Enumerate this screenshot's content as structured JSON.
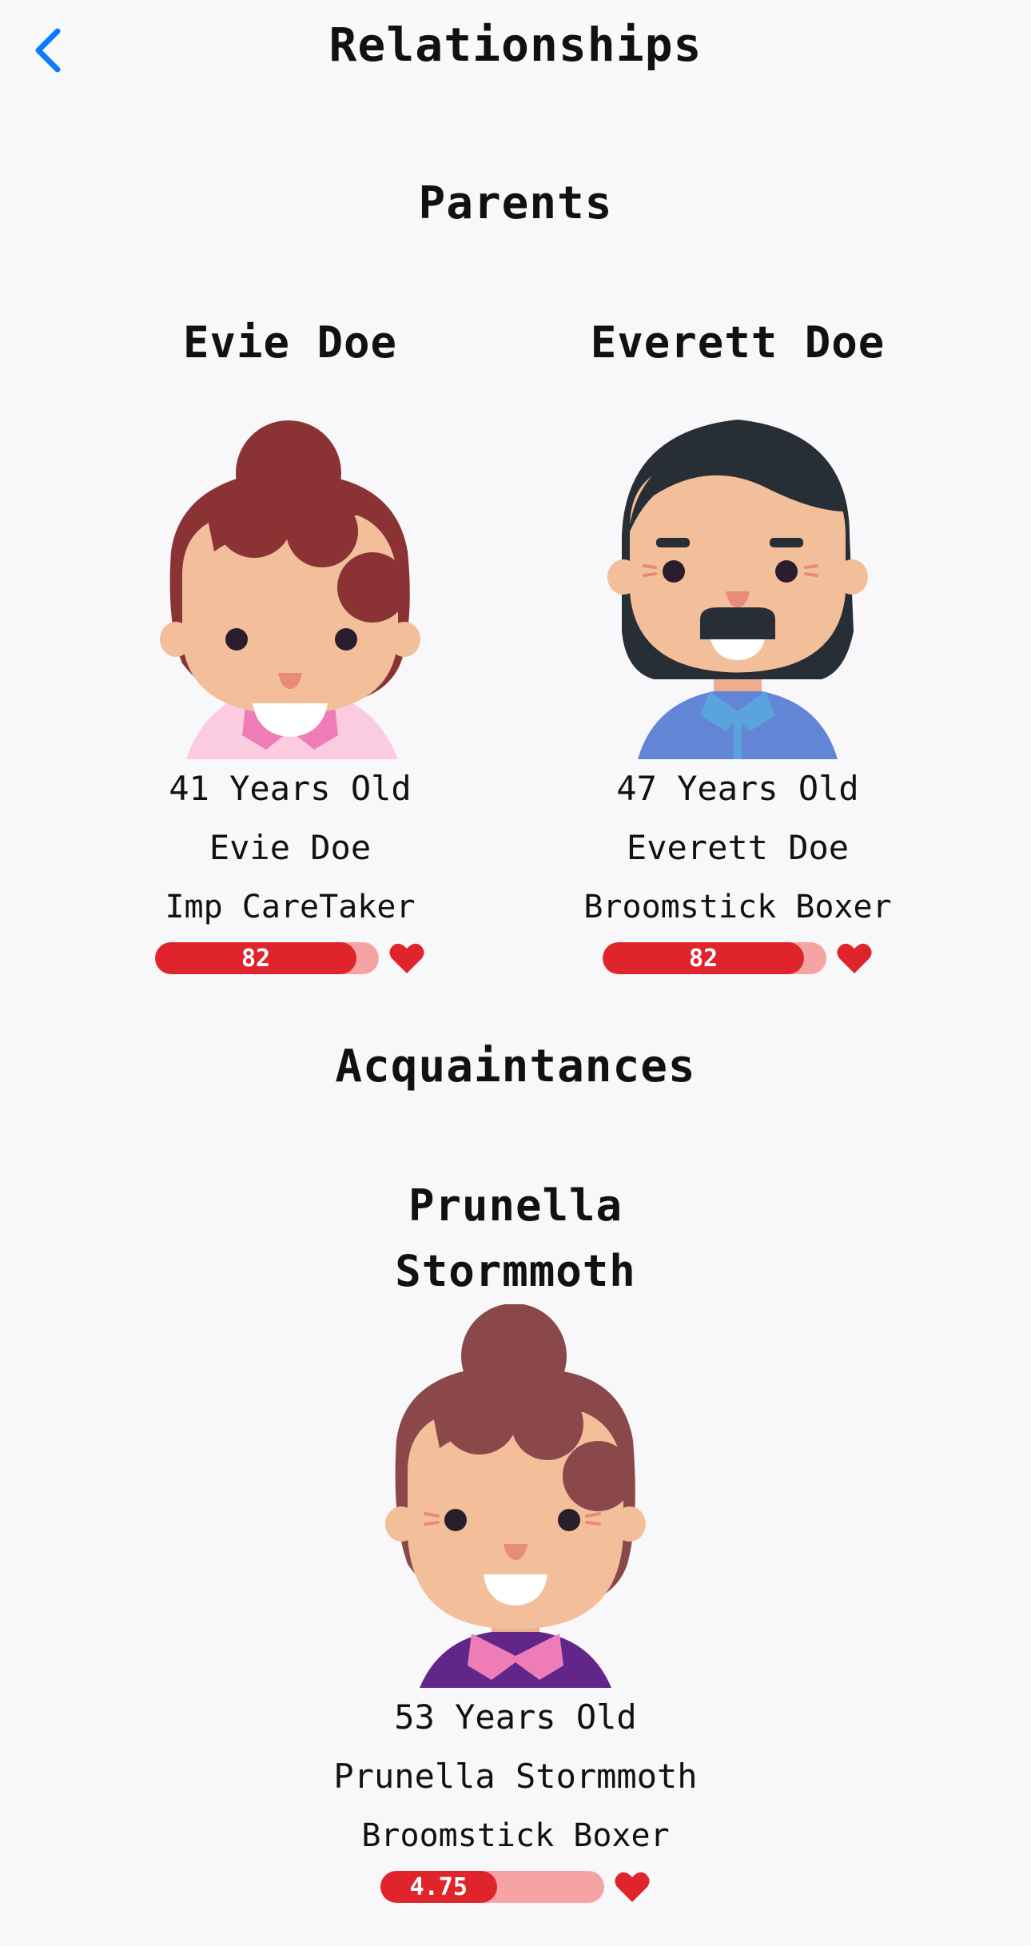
{
  "header": {
    "title": "Relationships"
  },
  "sections": [
    {
      "title": "Parents"
    },
    {
      "title": "Acquaintances"
    }
  ],
  "people": [
    {
      "name": "Evie Doe",
      "age_text": "41 Years Old",
      "full_name": "Evie Doe",
      "job": "Imp CareTaker",
      "relationship_value": 82,
      "relationship_fraction": 0.9
    },
    {
      "name": "Everett Doe",
      "age_text": "47 Years Old",
      "full_name": "Everett Doe",
      "job": "Broomstick Boxer",
      "relationship_value": 82,
      "relationship_fraction": 0.9
    },
    {
      "name": "Prunella Stormmoth",
      "age_text": "53 Years Old",
      "full_name": "Prunella Stormmoth",
      "job": "Broomstick Boxer",
      "relationship_value": 4.75,
      "relationship_fraction": 0.52
    }
  ],
  "colors": {
    "accent": "#0a7aff",
    "bar_fill": "#e0242b",
    "bar_track": "#f6a3a3",
    "heart": "#e0242b"
  }
}
